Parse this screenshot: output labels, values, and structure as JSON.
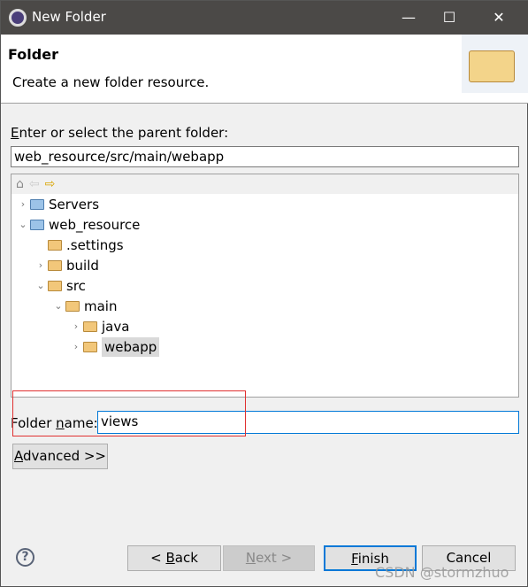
{
  "window": {
    "title": "New Folder",
    "icon": "eclipse-icon"
  },
  "header": {
    "title": "Folder",
    "description": "Create a new folder resource.",
    "icon": "folder-open-large-icon"
  },
  "parent": {
    "label_prefix": "E",
    "label_rest": "nter or select the parent folder:",
    "value": "web_resource/src/main/webapp"
  },
  "tree": {
    "toolbar": [
      "home-icon",
      "back-arrow-icon",
      "forward-arrow-icon"
    ],
    "items": [
      {
        "label": "Servers",
        "depth": 0,
        "toggle": "collapsed",
        "selected": false
      },
      {
        "label": "web_resource",
        "depth": 0,
        "toggle": "expanded",
        "selected": false
      },
      {
        "label": ".settings",
        "depth": 1,
        "toggle": "none",
        "selected": false
      },
      {
        "label": "build",
        "depth": 1,
        "toggle": "collapsed",
        "selected": false
      },
      {
        "label": "src",
        "depth": 1,
        "toggle": "expanded",
        "selected": false
      },
      {
        "label": "main",
        "depth": 2,
        "toggle": "expanded",
        "selected": false
      },
      {
        "label": "java",
        "depth": 3,
        "toggle": "collapsed",
        "selected": false
      },
      {
        "label": "webapp",
        "depth": 3,
        "toggle": "collapsed",
        "selected": true
      }
    ]
  },
  "folder_name": {
    "label_a": "Folder ",
    "label_u": "n",
    "label_b": "ame:",
    "value": "views"
  },
  "advanced": {
    "u": "A",
    "rest": "dvanced >>"
  },
  "buttons": {
    "back_a": "< ",
    "back_u": "B",
    "back_b": "ack",
    "next_u": "N",
    "next_b": "ext >",
    "finish_u": "F",
    "finish_b": "inish",
    "cancel": "Cancel"
  },
  "watermark": "CSDN @stormzhuo",
  "colors": {
    "titlebar": "#4b4947",
    "highlight": "#0078d7",
    "annotation": "#e03030"
  }
}
